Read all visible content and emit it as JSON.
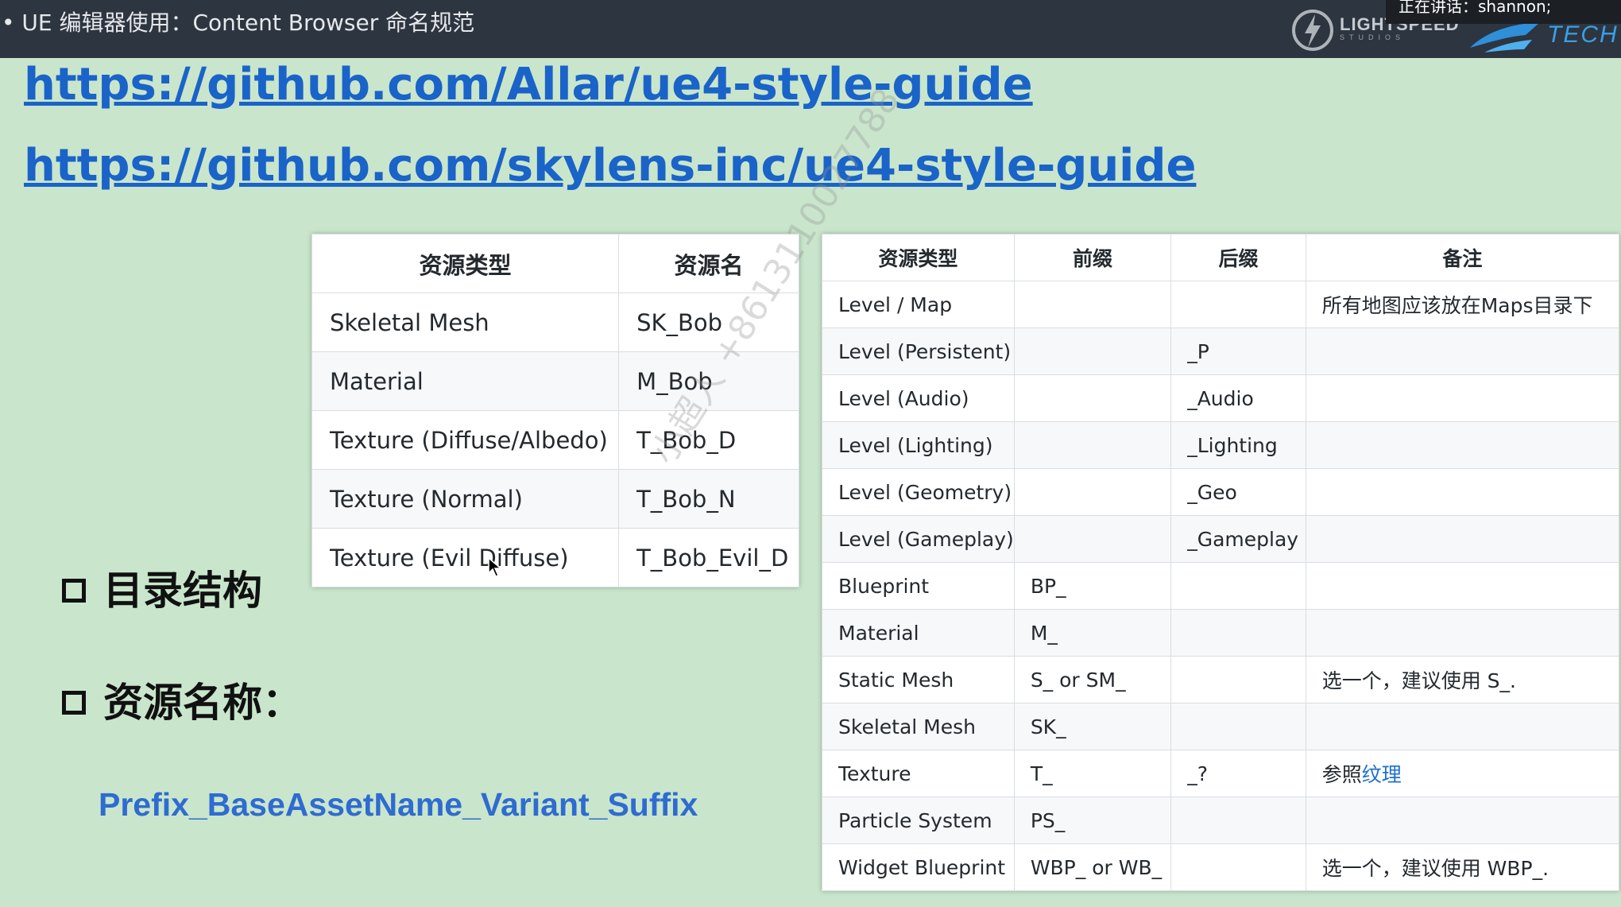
{
  "header": {
    "title": "• UE 编辑器使用：Content Browser 命名规范",
    "speaker": "正在讲话：shannon;",
    "logo_left": "LIGHTSPEED",
    "logo_left_sub": "STUDIOS",
    "logo_right": "TECH"
  },
  "links": [
    "https://github.com/Allar/ue4-style-guide",
    "https://github.com/skylens-inc/ue4-style-guide"
  ],
  "left_table": {
    "headers": [
      "资源类型",
      "资源名"
    ],
    "rows": [
      [
        "Skeletal Mesh",
        "SK_Bob"
      ],
      [
        "Material",
        "M_Bob"
      ],
      [
        "Texture (Diffuse/Albedo)",
        "T_Bob_D"
      ],
      [
        "Texture (Normal)",
        "T_Bob_N"
      ],
      [
        "Texture (Evil Diffuse)",
        "T_Bob_Evil_D"
      ]
    ]
  },
  "right_table": {
    "headers": [
      "资源类型",
      "前缀",
      "后缀",
      "备注"
    ],
    "rows": [
      [
        "Level / Map",
        "",
        "",
        "所有地图应该放在Maps目录下"
      ],
      [
        "Level (Persistent)",
        "",
        "_P",
        ""
      ],
      [
        "Level (Audio)",
        "",
        "_Audio",
        ""
      ],
      [
        "Level (Lighting)",
        "",
        "_Lighting",
        ""
      ],
      [
        "Level (Geometry)",
        "",
        "_Geo",
        ""
      ],
      [
        "Level (Gameplay)",
        "",
        "_Gameplay",
        ""
      ],
      [
        "Blueprint",
        "BP_",
        "",
        ""
      ],
      [
        "Material",
        "M_",
        "",
        ""
      ],
      [
        "Static Mesh",
        "S_ or SM_",
        "",
        "选一个，建议使用 S_."
      ],
      [
        "Skeletal Mesh",
        "SK_",
        "",
        ""
      ],
      [
        "Texture",
        "T_",
        "_?",
        ""
      ],
      [
        "Particle System",
        "PS_",
        "",
        ""
      ],
      [
        "Widget Blueprint",
        "WBP_ or WB_",
        "",
        "选一个，建议使用 WBP_."
      ]
    ],
    "texture_note_prefix": "参照",
    "texture_note_link": "纹理"
  },
  "bullets": [
    "目录结构",
    "资源名称："
  ],
  "formula": "Prefix_BaseAssetName_Variant_Suffix",
  "watermark": "小超人 +8613110027788",
  "colors": {
    "topbar": "#2d3540",
    "background": "#c9e6cc",
    "link": "#1a63c8",
    "formula": "#2f6bd0"
  }
}
